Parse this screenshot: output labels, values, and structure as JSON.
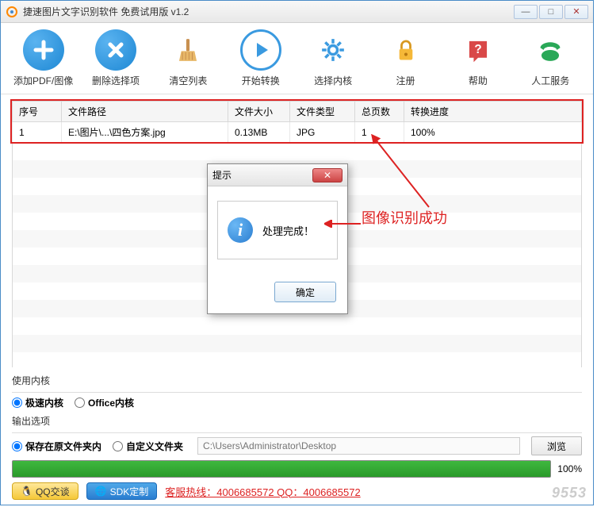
{
  "window": {
    "title": "捷速图片文字识别软件 免费试用版 v1.2"
  },
  "toolbar": [
    {
      "id": "add",
      "label": "添加PDF/图像"
    },
    {
      "id": "delete",
      "label": "删除选择项"
    },
    {
      "id": "clear",
      "label": "清空列表"
    },
    {
      "id": "start",
      "label": "开始转换"
    },
    {
      "id": "kernel",
      "label": "选择内核"
    },
    {
      "id": "register",
      "label": "注册"
    },
    {
      "id": "help",
      "label": "帮助"
    },
    {
      "id": "service",
      "label": "人工服务"
    }
  ],
  "table": {
    "headers": [
      "序号",
      "文件路径",
      "文件大小",
      "文件类型",
      "总页数",
      "转换进度"
    ],
    "rows": [
      {
        "seq": "1",
        "path": "E:\\图片\\...\\四色方案.jpg",
        "size": "0.13MB",
        "type": "JPG",
        "pages": "1",
        "progress": "100%"
      }
    ]
  },
  "dialog": {
    "title": "提示",
    "message": "处理完成！",
    "ok": "确定"
  },
  "annotation": {
    "text": "图像识别成功"
  },
  "options": {
    "kernel_label": "使用内核",
    "kernel_fast": "极速内核",
    "kernel_office": "Office内核",
    "output_label": "输出选项",
    "output_same": "保存在原文件夹内",
    "output_custom": "自定义文件夹",
    "path_placeholder": "C:\\Users\\Administrator\\Desktop",
    "browse": "浏览"
  },
  "progress": {
    "percent": "100%"
  },
  "footer": {
    "qq_talk": "QQ交谈",
    "sdk": "SDK定制",
    "hotline": "客服热线：4006685572 QQ：4006685572"
  },
  "watermark": "9553"
}
